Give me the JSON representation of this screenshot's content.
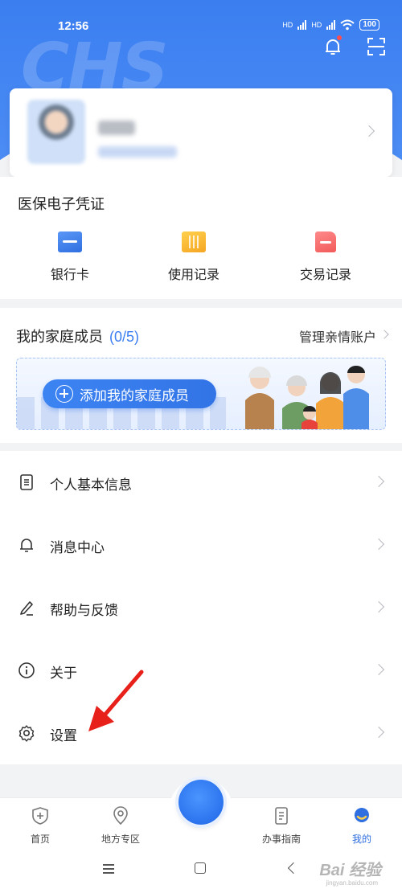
{
  "status": {
    "time": "12:56",
    "battery": "100",
    "net1": "HD",
    "net2": "HD"
  },
  "header": {
    "logo_text": "CHS"
  },
  "voucher": {
    "title": "医保电子凭证",
    "items": [
      {
        "label": "银行卡",
        "icon": "bank-card-icon"
      },
      {
        "label": "使用记录",
        "icon": "usage-record-icon"
      },
      {
        "label": "交易记录",
        "icon": "transaction-record-icon"
      }
    ]
  },
  "family": {
    "title": "我的家庭成员",
    "count": "(0/5)",
    "manage_label": "管理亲情账户",
    "add_label": "添加我的家庭成员"
  },
  "menu": {
    "items": [
      {
        "label": "个人基本信息",
        "icon": "document-icon"
      },
      {
        "label": "消息中心",
        "icon": "bell-icon"
      },
      {
        "label": "帮助与反馈",
        "icon": "pen-icon"
      },
      {
        "label": "关于",
        "icon": "info-icon"
      },
      {
        "label": "设置",
        "icon": "gear-icon"
      }
    ]
  },
  "tabbar": {
    "tabs": [
      {
        "label": "首页",
        "icon": "shield-plus-icon"
      },
      {
        "label": "地方专区",
        "icon": "location-pin-icon"
      },
      {
        "label": "办事指南",
        "icon": "guide-doc-icon"
      },
      {
        "label": "我的",
        "icon": "profile-icon",
        "active": true
      }
    ]
  },
  "watermark": {
    "text": "Bai 经验",
    "sub": "jingyan.baidu.com"
  },
  "colors": {
    "primary": "#3b7ef0",
    "accent_red": "#ff4d4f",
    "annotation_red": "#e8201a"
  }
}
